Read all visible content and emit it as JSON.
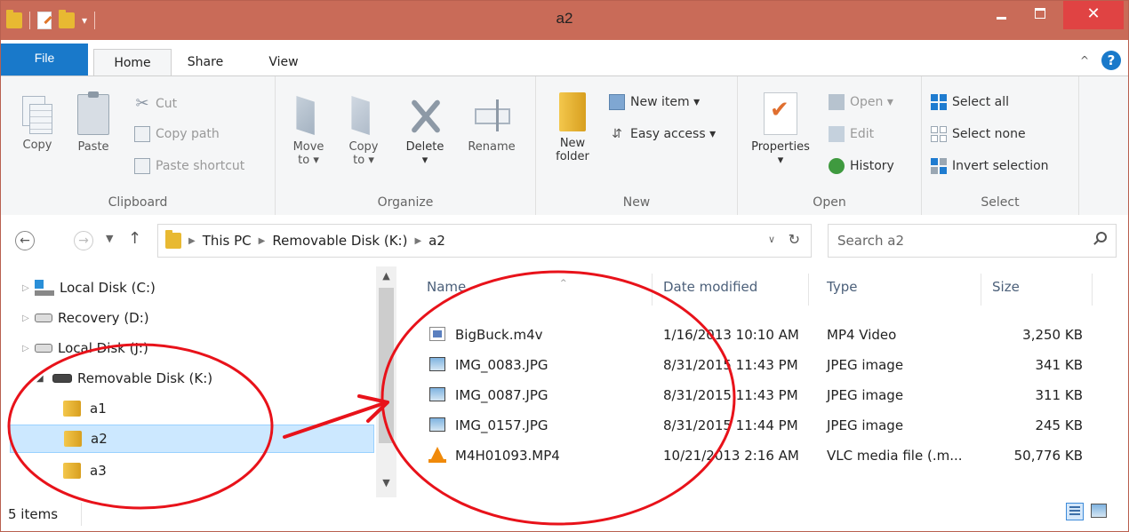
{
  "window": {
    "title": "a2",
    "close_glyph": "✕"
  },
  "tabs": {
    "file": "File",
    "home": "Home",
    "share": "Share",
    "view": "View"
  },
  "ribbon": {
    "clipboard": {
      "caption": "Clipboard",
      "copy": "Copy",
      "paste": "Paste",
      "cut": "Cut",
      "copy_path": "Copy path",
      "paste_shortcut": "Paste shortcut"
    },
    "organize": {
      "caption": "Organize",
      "move_to_1": "Move",
      "move_to_2": "to ▾",
      "copy_to_1": "Copy",
      "copy_to_2": "to ▾",
      "delete": "Delete",
      "delete_drop": "▾",
      "rename": "Rename"
    },
    "new": {
      "caption": "New",
      "new_folder_1": "New",
      "new_folder_2": "folder",
      "new_item": "New item ▾",
      "easy_access": "Easy access ▾"
    },
    "open": {
      "caption": "Open",
      "properties": "Properties",
      "properties_drop": "▾",
      "open": "Open ▾",
      "edit": "Edit",
      "history": "History"
    },
    "select": {
      "caption": "Select",
      "select_all": "Select all",
      "select_none": "Select none",
      "invert_selection": "Invert selection"
    }
  },
  "address": {
    "crumbs": [
      "This PC",
      "Removable Disk (K:)",
      "a2"
    ],
    "search_placeholder": "Search a2"
  },
  "nav_tree": [
    {
      "label": "Local Disk (C:)"
    },
    {
      "label": "Recovery (D:)"
    },
    {
      "label": "Local Disk (J:)"
    },
    {
      "label": "Removable Disk (K:)"
    },
    {
      "label": "a1"
    },
    {
      "label": "a2"
    },
    {
      "label": "a3"
    }
  ],
  "file_list": {
    "columns": [
      "Name",
      "Date modified",
      "Type",
      "Size"
    ],
    "rows": [
      {
        "name": "BigBuck.m4v",
        "date": "1/16/2013 10:10 AM",
        "type": "MP4 Video",
        "size": "3,250 KB",
        "icon": "video-file-icon"
      },
      {
        "name": "IMG_0083.JPG",
        "date": "8/31/2015 11:43 PM",
        "type": "JPEG image",
        "size": "341 KB",
        "icon": "image-file-icon"
      },
      {
        "name": "IMG_0087.JPG",
        "date": "8/31/2015 11:43 PM",
        "type": "JPEG image",
        "size": "311 KB",
        "icon": "image-file-icon"
      },
      {
        "name": "IMG_0157.JPG",
        "date": "8/31/2015 11:44 PM",
        "type": "JPEG image",
        "size": "245 KB",
        "icon": "image-file-icon"
      },
      {
        "name": "M4H01093.MP4",
        "date": "10/21/2013 2:16 AM",
        "type": "VLC media file (.m...",
        "size": "50,776 KB",
        "icon": "vlc-file-icon"
      }
    ]
  },
  "status": {
    "item_count": "5 items"
  },
  "colors": {
    "titlebar": "#c96b58",
    "file_tab": "#1979ca",
    "close_button": "#e04343",
    "selection": "#cce8ff",
    "annotation": "#e8121a"
  }
}
